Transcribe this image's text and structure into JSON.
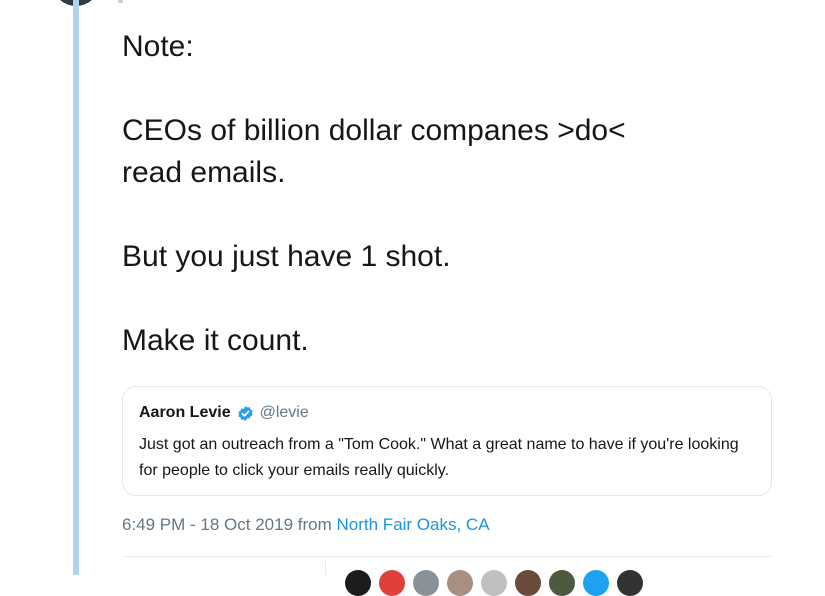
{
  "tweet": {
    "lines": {
      "note": "Note:",
      "ceos_1": "CEOs of billion dollar companes >do<",
      "ceos_2": "read emails.",
      "shot": "But you just have 1 shot.",
      "count": "Make it count."
    }
  },
  "quote": {
    "name": "Aaron Levie",
    "handle": "@levie",
    "text": "Just got an outreach from a \"Tom Cook.\" What a great name to have if you're looking for people to click your emails really quickly.",
    "verified_icon": "verified-badge-icon"
  },
  "meta": {
    "time_date": "6:49 PM - 18 Oct 2019",
    "from": "from",
    "location": "North Fair Oaks, CA"
  },
  "colors": {
    "thread_line": "#b1d3ee",
    "link": "#1b95e0",
    "verified": "#1da1f2"
  },
  "mini_avatar_colors": [
    "#1c1c1c",
    "#e0403a",
    "#8b9297",
    "#a78f82",
    "#c0c0c0",
    "#6a4a3a",
    "#4d5a3f",
    "#1da1f2",
    "#333333"
  ]
}
